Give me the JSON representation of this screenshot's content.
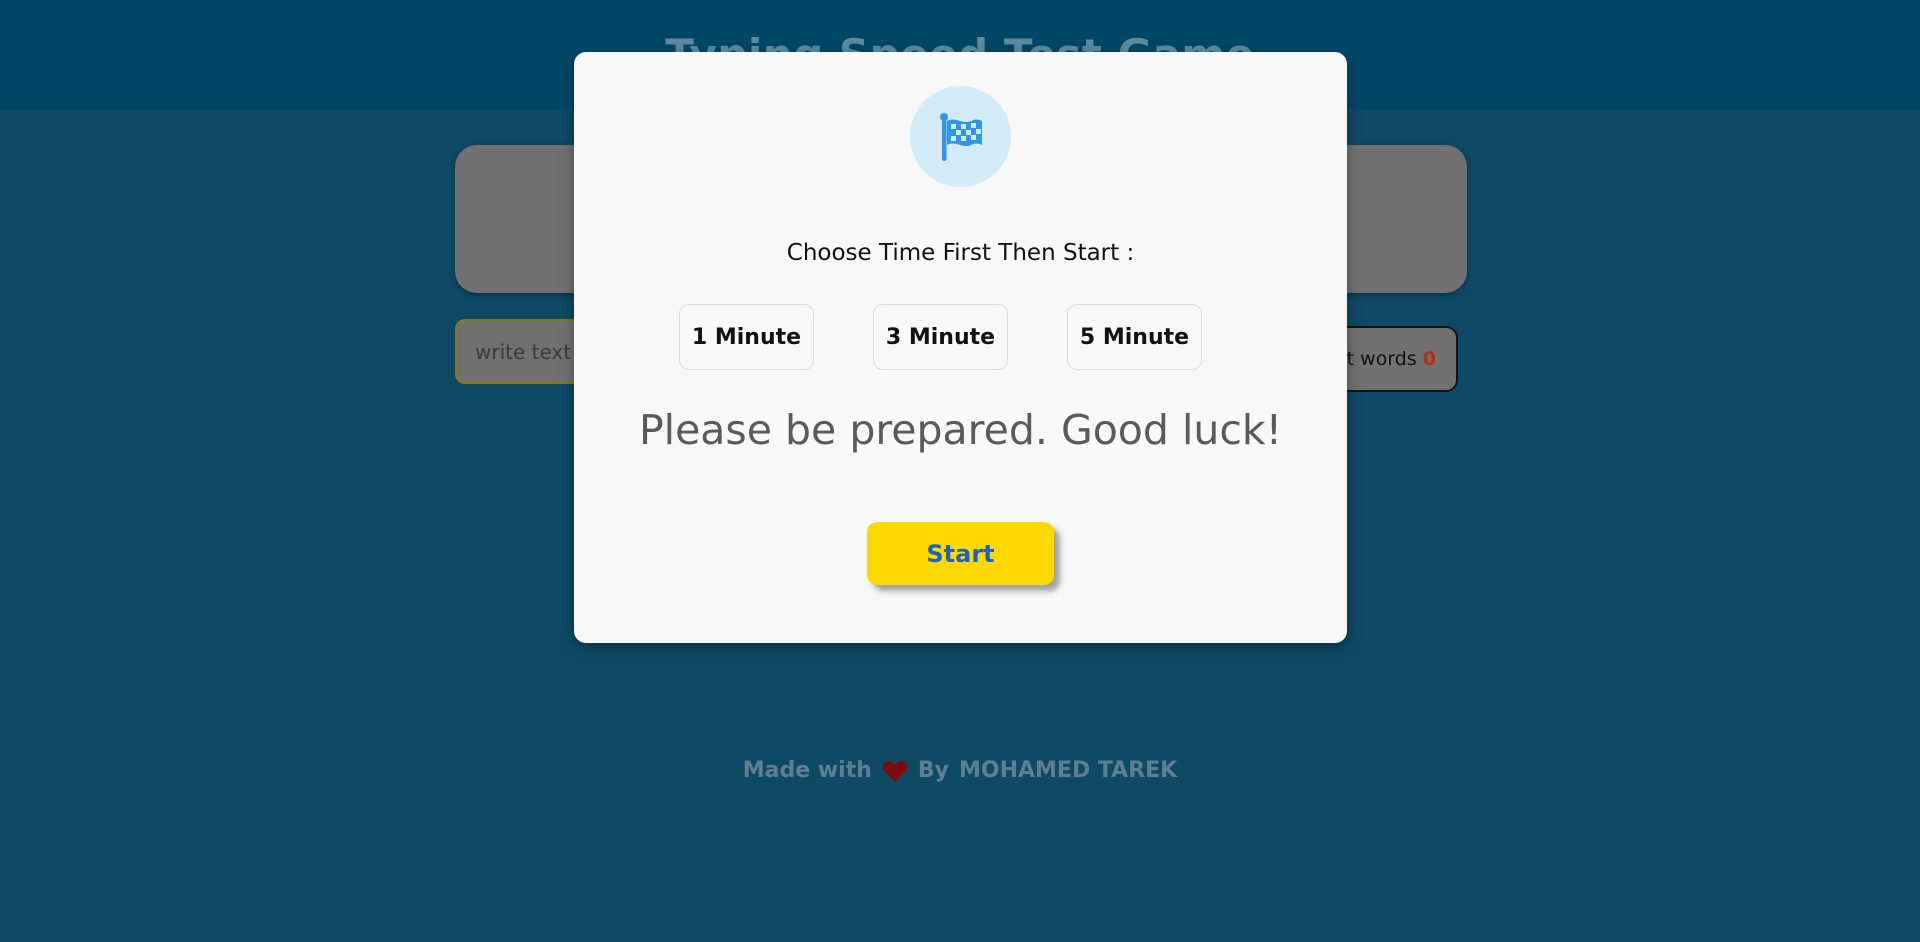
{
  "header": {
    "title": "Typing Speed Test Game"
  },
  "typing": {
    "input_placeholder": "write text h",
    "correct_label": "ct words",
    "correct_count": "0"
  },
  "footer": {
    "made_with": "Made with",
    "by": "By",
    "author": "MOHAMED TAREK"
  },
  "modal": {
    "icon": "checkered-flag-icon",
    "choose_text": "Choose Time First Then Start :",
    "time_options": [
      "1 Minute",
      "3 Minute",
      "5 Minute"
    ],
    "prepare_text": "Please be prepared. Good luck!",
    "start_label": "Start"
  },
  "colors": {
    "header_bg": "#004767",
    "page_bg": "#0e4a65",
    "start_button": "#ffd800",
    "start_text": "#1a62c7",
    "flag_blue": "#2f96e6",
    "heart": "#7a0d0d",
    "count_red": "#b92b11"
  }
}
